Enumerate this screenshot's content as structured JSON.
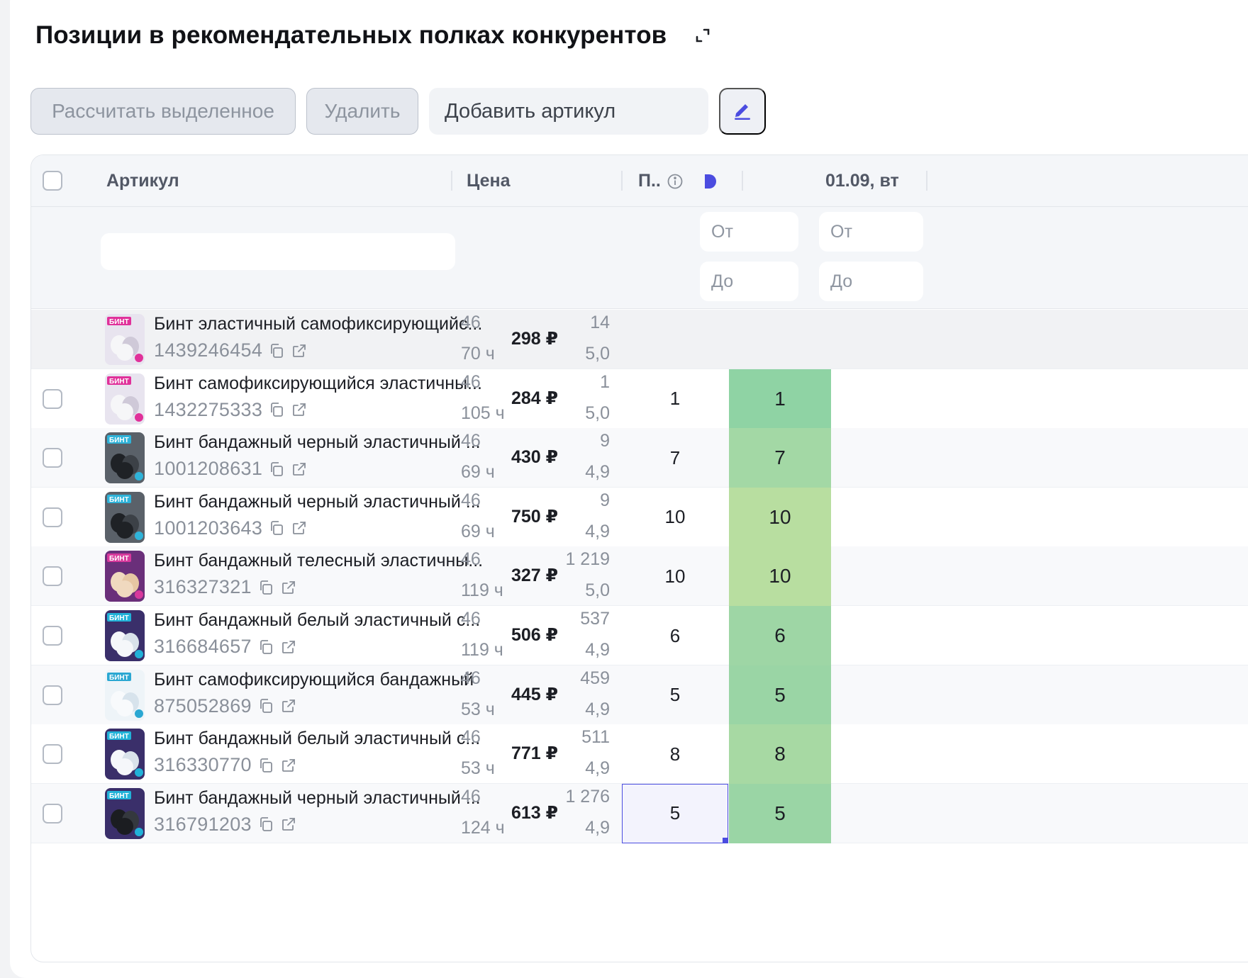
{
  "title": "Позиции в рекомендательных полках конкурентов",
  "toolbar": {
    "calc_label": "Рассчитать выделенное",
    "delete_label": "Удалить",
    "add_placeholder": "Добавить артикул"
  },
  "columns": {
    "article": "Артикул",
    "price": "Цена",
    "position": "П..",
    "date": "01.09, вт"
  },
  "filters": {
    "from": "От",
    "to": "До"
  },
  "colors": {
    "accent": "#4b4ce0",
    "heat_green": "#8fd3a4",
    "heat_lightgreen": "#b5dd9e"
  },
  "rows": [
    {
      "name": "Бинт эластичный самофиксирующийс...",
      "sku": "1439246454",
      "position": "46",
      "hours": "70 ч",
      "price": "298 ₽",
      "sales": "14",
      "rating": "5,0",
      "pos_value": "",
      "date_value": "",
      "heat": "none",
      "thumb": "white",
      "checkbox": false
    },
    {
      "name": "Бинт самофиксирующийся эластичны...",
      "sku": "1432275333",
      "position": "46",
      "hours": "105 ч",
      "price": "284 ₽",
      "sales": "1",
      "rating": "5,0",
      "pos_value": "1",
      "date_value": "1",
      "heat": "#8fd3a4",
      "thumb": "white",
      "checkbox": true
    },
    {
      "name": "Бинт бандажный черный эластичный ...",
      "sku": "1001208631",
      "position": "46",
      "hours": "69 ч",
      "price": "430 ₽",
      "sales": "9",
      "rating": "4,9",
      "pos_value": "7",
      "date_value": "7",
      "heat": "#a3d8a5",
      "thumb": "black",
      "checkbox": true
    },
    {
      "name": "Бинт бандажный черный эластичный ...",
      "sku": "1001203643",
      "position": "46",
      "hours": "69 ч",
      "price": "750 ₽",
      "sales": "9",
      "rating": "4,9",
      "pos_value": "10",
      "date_value": "10",
      "heat": "#b8dea0",
      "thumb": "black",
      "checkbox": true
    },
    {
      "name": "Бинт бандажный телесный эластичны...",
      "sku": "316327321",
      "position": "46",
      "hours": "119 ч",
      "price": "327 ₽",
      "sales": "1 219",
      "rating": "5,0",
      "pos_value": "10",
      "date_value": "10",
      "heat": "#b8dea0",
      "thumb": "beige",
      "checkbox": true
    },
    {
      "name": "Бинт бандажный белый эластичный с...",
      "sku": "316684657",
      "position": "46",
      "hours": "119 ч",
      "price": "506 ₽",
      "sales": "537",
      "rating": "4,9",
      "pos_value": "6",
      "date_value": "6",
      "heat": "#9ed6a5",
      "thumb": "whiteblue",
      "checkbox": true
    },
    {
      "name": "Бинт самофиксирующийся бандажный",
      "sku": "875052869",
      "position": "46",
      "hours": "53 ч",
      "price": "445 ₽",
      "sales": "459",
      "rating": "4,9",
      "pos_value": "5",
      "date_value": "5",
      "heat": "#9ad5a5",
      "thumb": "light",
      "checkbox": true
    },
    {
      "name": "Бинт бандажный белый эластичный с...",
      "sku": "316330770",
      "position": "46",
      "hours": "53 ч",
      "price": "771 ₽",
      "sales": "511",
      "rating": "4,9",
      "pos_value": "8",
      "date_value": "8",
      "heat": "#a7d9a3",
      "thumb": "whiteblue",
      "checkbox": true
    },
    {
      "name": "Бинт бандажный черный эластичный ...",
      "sku": "316791203",
      "position": "46",
      "hours": "124 ч",
      "price": "613 ₽",
      "sales": "1 276",
      "rating": "4,9",
      "pos_value": "5",
      "date_value": "5",
      "heat": "#9ad5a5",
      "thumb": "blackblue",
      "checkbox": true,
      "selected": true
    }
  ]
}
